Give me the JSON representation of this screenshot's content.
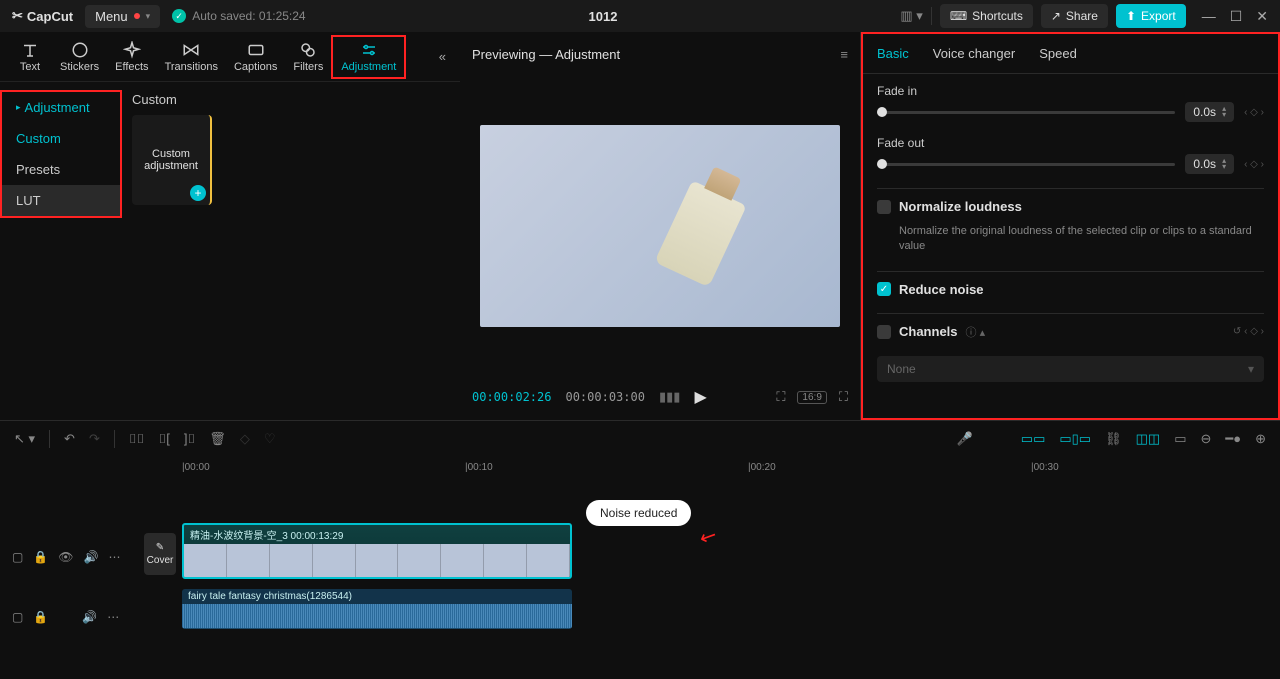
{
  "titlebar": {
    "app": "CapCut",
    "menu": "Menu",
    "autosave": "Auto saved: 01:25:24",
    "project": "1012",
    "shortcuts": "Shortcuts",
    "share": "Share",
    "export": "Export"
  },
  "tool_tabs": [
    "Text",
    "Stickers",
    "Effects",
    "Transitions",
    "Captions",
    "Filters",
    "Adjustment"
  ],
  "sidenav": {
    "header": "Adjustment",
    "items": [
      "Custom",
      "Presets",
      "LUT"
    ]
  },
  "assets": {
    "section": "Custom",
    "card": "Custom adjustment"
  },
  "preview": {
    "title": "Previewing — Adjustment",
    "cur": "00:00:02:26",
    "tot": "00:00:03:00",
    "ratio": "16:9"
  },
  "inspector": {
    "tabs": [
      "Basic",
      "Voice changer",
      "Speed"
    ],
    "fadein_label": "Fade in",
    "fadein_val": "0.0s",
    "fadeout_label": "Fade out",
    "fadeout_val": "0.0s",
    "norm_label": "Normalize loudness",
    "norm_desc": "Normalize the original loudness of the selected clip or clips to a standard value",
    "reduce_label": "Reduce noise",
    "channels_label": "Channels",
    "channels_val": "None"
  },
  "timeline": {
    "ticks": [
      "00:00",
      "00:10",
      "00:20",
      "00:30"
    ],
    "cover": "Cover",
    "video_clip": "精油-水波纹背景-空_3   00:00:13:29",
    "audio_clip": "fairy tale fantasy christmas(1286544)"
  },
  "tooltip": "Noise reduced"
}
